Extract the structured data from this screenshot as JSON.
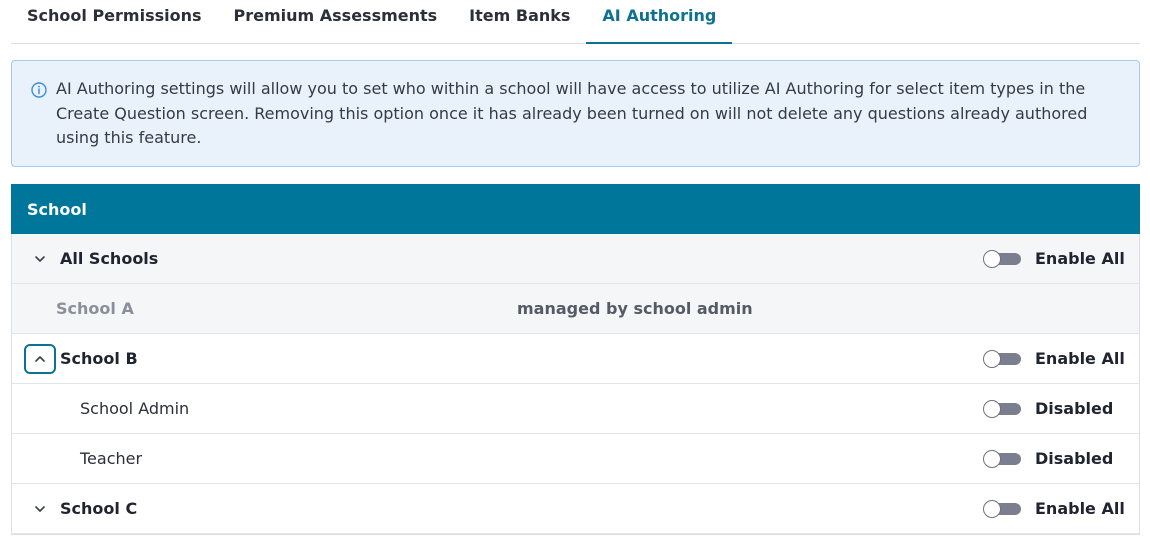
{
  "tabs": [
    {
      "label": "School Permissions"
    },
    {
      "label": "Premium Assessments"
    },
    {
      "label": "Item Banks"
    },
    {
      "label": "AI Authoring"
    }
  ],
  "active_tab": "AI Authoring",
  "info": {
    "text": "AI Authoring settings will allow you to set who within a school will have access to utilize AI Authoring for select item types in the Create Question screen. Removing this option once it has already been turned on will not delete any questions already authored using this feature."
  },
  "table": {
    "header": "School",
    "rows": [
      {
        "name": "All Schools",
        "toggle_label": "Enable All",
        "enabled": false
      },
      {
        "name": "School A",
        "note": "managed by school admin"
      },
      {
        "name": "School B",
        "toggle_label": "Enable All",
        "enabled": false
      },
      {
        "name": "School Admin",
        "toggle_label": "Disabled",
        "enabled": false
      },
      {
        "name": "Teacher",
        "toggle_label": "Disabled",
        "enabled": false
      },
      {
        "name": "School C",
        "toggle_label": "Enable All",
        "enabled": false
      }
    ]
  },
  "colors": {
    "accent": "#00769b",
    "info_bg": "#e9f2fb",
    "toggle_off": "#7b7e8e"
  }
}
